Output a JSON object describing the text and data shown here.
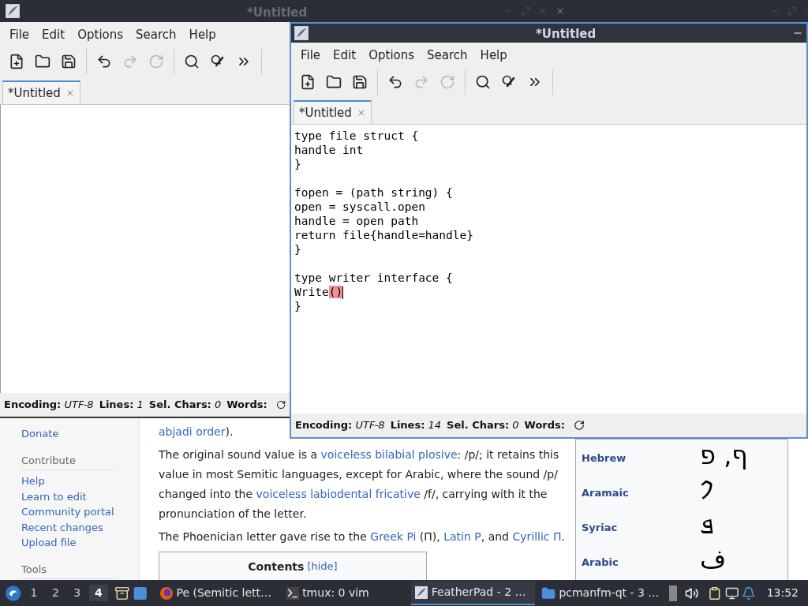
{
  "top_bar": {
    "title": "*Untitled"
  },
  "back_window": {
    "menu": [
      "File",
      "Edit",
      "Options",
      "Search",
      "Help"
    ],
    "toolbar": [
      {
        "kind": "new",
        "disabled": false
      },
      {
        "kind": "open",
        "disabled": false
      },
      {
        "kind": "save",
        "disabled": false
      },
      {
        "kind": "separator"
      },
      {
        "kind": "undo",
        "disabled": false
      },
      {
        "kind": "redo",
        "disabled": true
      },
      {
        "kind": "reload",
        "disabled": true
      },
      {
        "kind": "separator"
      },
      {
        "kind": "find",
        "disabled": false
      },
      {
        "kind": "replace",
        "disabled": false
      },
      {
        "kind": "more",
        "disabled": false
      }
    ],
    "tabs": [
      {
        "label": "*Untitled",
        "selected": true
      }
    ],
    "status": [
      {
        "label": "Encoding:",
        "value": "UTF-8"
      },
      {
        "label": "Lines:",
        "value": "1"
      },
      {
        "label": "Sel. Chars:",
        "value": "0"
      },
      {
        "label": "Words:"
      }
    ]
  },
  "front_window": {
    "title": "*Untitled",
    "menu": [
      "File",
      "Edit",
      "Options",
      "Search",
      "Help"
    ],
    "toolbar": [
      {
        "kind": "new",
        "disabled": false
      },
      {
        "kind": "open",
        "disabled": false
      },
      {
        "kind": "save",
        "disabled": false
      },
      {
        "kind": "separator"
      },
      {
        "kind": "undo",
        "disabled": false
      },
      {
        "kind": "redo",
        "disabled": true
      },
      {
        "kind": "reload",
        "disabled": true
      },
      {
        "kind": "separator"
      },
      {
        "kind": "find",
        "disabled": false
      },
      {
        "kind": "replace",
        "disabled": false
      },
      {
        "kind": "more",
        "disabled": false
      }
    ],
    "tabs": [
      {
        "label": "*Untitled",
        "selected": true
      }
    ],
    "code_lines": [
      {
        "kind": "text",
        "text": "type file struct {"
      },
      {
        "kind": "text",
        "text": "handle int"
      },
      {
        "kind": "text",
        "text": "}"
      },
      {
        "kind": "blank"
      },
      {
        "kind": "text",
        "text": "fopen = (path string) {"
      },
      {
        "kind": "text",
        "text": "open = syscall.open"
      },
      {
        "kind": "text",
        "text": "handle = open path"
      },
      {
        "kind": "text",
        "text": "return file{handle=handle}"
      },
      {
        "kind": "text",
        "text": "}"
      },
      {
        "kind": "blank"
      },
      {
        "kind": "text",
        "text": "type writer interface {"
      },
      {
        "kind": "text",
        "text": "Write",
        "matched_brackets": "()",
        "cursor": true
      },
      {
        "kind": "text",
        "text": "}"
      }
    ],
    "status": [
      {
        "label": "Encoding:",
        "value": "UTF-8"
      },
      {
        "label": "Lines:",
        "value": "14"
      },
      {
        "label": "Sel. Chars:",
        "value": "0"
      },
      {
        "label": "Words:"
      }
    ]
  },
  "browser": {
    "sidebar": [
      {
        "items": [
          "Donate"
        ]
      },
      {
        "heading": "Contribute",
        "items": [
          "Help",
          "Learn to edit",
          "Community portal",
          "Recent changes",
          "Upload file"
        ]
      },
      {
        "heading": "Tools"
      }
    ],
    "paragraphs": [
      [
        {
          "text": "abjadi order",
          "link": true
        },
        {
          "text": ").",
          "link": false
        }
      ],
      [
        {
          "text": "The original sound value is a ",
          "link": false
        },
        {
          "text": "voiceless bilabial plosive",
          "link": true
        },
        {
          "text": ": /p/; it retains this value in most Semitic languages, except for Arabic, where the sound /p/ changed into the ",
          "link": false
        },
        {
          "text": "voiceless labiodental fricative",
          "link": true
        },
        {
          "text": " /f/, carrying with it the pronunciation of the letter.",
          "link": false
        }
      ],
      [
        {
          "text": "The Phoenician letter gave rise to the ",
          "link": false
        },
        {
          "text": "Greek Pi",
          "link": true
        },
        {
          "text": " (Π), ",
          "link": false
        },
        {
          "text": "Latin P",
          "link": true
        },
        {
          "text": ", and ",
          "link": false
        },
        {
          "text": "Cyrillic П",
          "link": true
        },
        {
          "text": ".",
          "link": false
        }
      ]
    ],
    "contents": {
      "title": "Contents",
      "toggle": "[hide]"
    },
    "infobox": [
      {
        "language": "Hebrew",
        "glyph": "ף, פ"
      },
      {
        "language": "Aramaic",
        "glyph": "𐡐"
      },
      {
        "language": "Syriac",
        "glyph": "ܦ"
      },
      {
        "language": "Arabic",
        "glyph": "ف"
      }
    ]
  },
  "taskbar": {
    "workspaces": [
      {
        "label": "1",
        "selected": false
      },
      {
        "label": "2",
        "selected": false
      },
      {
        "label": "3",
        "selected": false
      },
      {
        "label": "4",
        "selected": true
      }
    ],
    "tasks": [
      {
        "kind": "firefox",
        "label": "Pe (Semitic lett…",
        "selected": false
      },
      {
        "kind": "terminal",
        "label": "tmux: 0 vim",
        "selected": false
      },
      {
        "kind": "featherpad",
        "label": "FeatherPad - 2 …",
        "selected": true
      },
      {
        "kind": "folder",
        "label": "pcmanfm-qt - 3 …",
        "selected": false
      }
    ],
    "clock": "13:52"
  }
}
